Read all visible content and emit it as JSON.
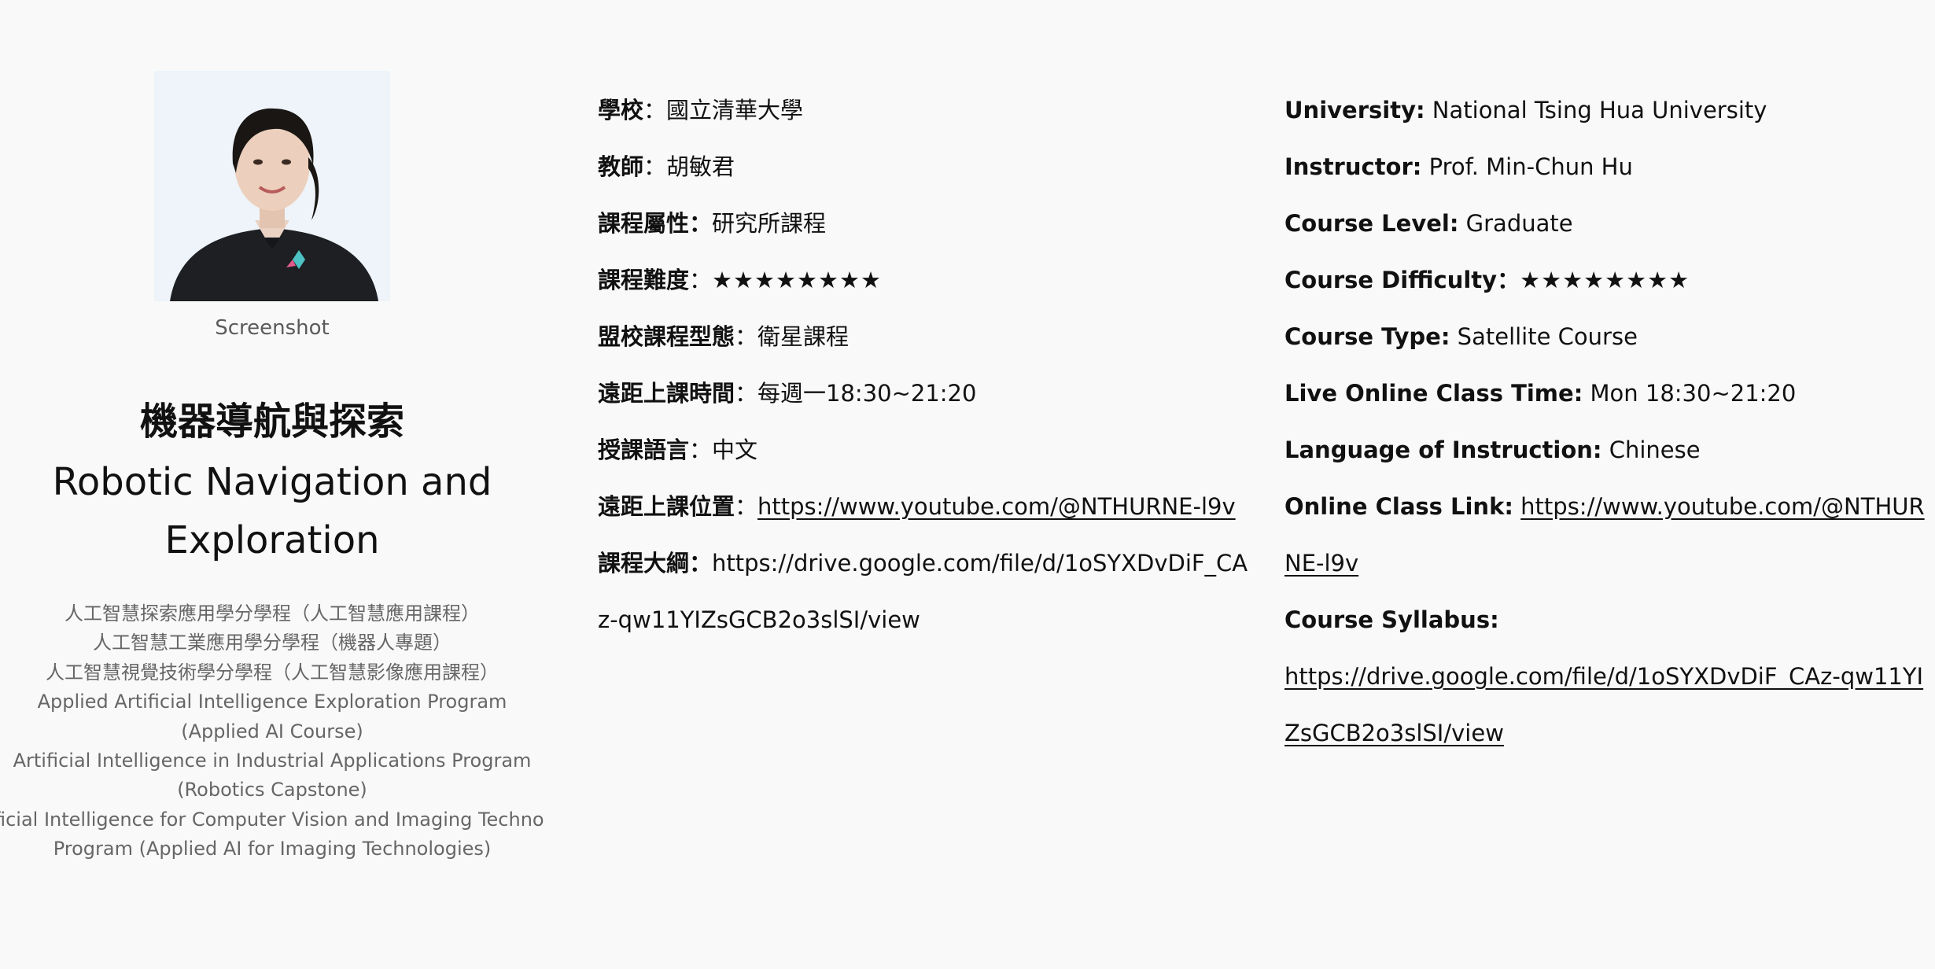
{
  "profile": {
    "photo_caption": "Screenshot",
    "title_zh": "機器導航與探索",
    "title_en": "Robotic Navigation and Exploration",
    "programs": [
      "人工智慧探索應用學分學程（人工智慧應用課程）",
      "人工智慧工業應用學分學程（機器人專題）",
      "人工智慧視覺技術學分學程（人工智慧影像應用課程）",
      "Applied Artificial Intelligence Exploration Program",
      "(Applied AI Course)",
      "Artificial Intelligence in Industrial Applications Program",
      "(Robotics Capstone)",
      "Artificial Intelligence for Computer Vision and Imaging Technology",
      "Program (Applied AI for Imaging Technologies)"
    ]
  },
  "zh": {
    "school_label": "學校",
    "school_value": "：國立清華大學",
    "teacher_label": "教師",
    "teacher_value": "：胡敏君",
    "attr_label": "課程屬性：",
    "attr_value": "研究所課程",
    "difficulty_label": "課程難度",
    "difficulty_sep": "：",
    "difficulty_stars": "★★★★★★★★",
    "type_label": "盟校課程型態",
    "type_value": "：衛星課程",
    "time_label": "遠距上課時間",
    "time_value": "：每週一18:30~21:20",
    "lang_label": "授課語言",
    "lang_value": "：中文",
    "location_label": "遠距上課位置",
    "location_sep": "：",
    "location_link": "https://www.youtube.com/@NTHURNE-l9v",
    "syllabus_label": "課程大綱：",
    "syllabus_link": "https://drive.google.com/file/d/1oSYXDvDiF_CAz-qw11YIZsGCB2o3slSI/view"
  },
  "en": {
    "university_label": "University:",
    "university_value": " National Tsing Hua University",
    "instructor_label": "Instructor:",
    "instructor_value": " Prof. Min-Chun Hu",
    "level_label": "Course Level:",
    "level_value": " Graduate",
    "difficulty_label": "Course Difficulty：",
    "difficulty_stars": "★★★★★★★★",
    "type_label": "Course Type:",
    "type_value": " Satellite Course",
    "time_label": "Live Online Class Time:",
    "time_value": " Mon 18:30~21:20",
    "lang_label": "Language of Instruction:",
    "lang_value": " Chinese",
    "link_label": "Online Class Link:",
    "link_value": "https://www.youtube.com/@NTHURNE-l9v",
    "syllabus_label": "Course Syllabus:",
    "syllabus_link": "https://drive.google.com/file/d/1oSYXDvDiF_CAz-qw11YIZsGCB2o3slSI/view"
  }
}
